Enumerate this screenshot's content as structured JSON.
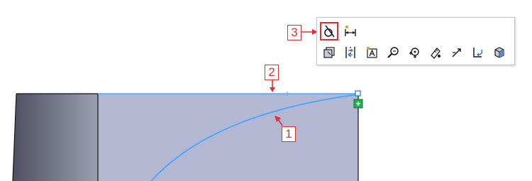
{
  "canvas": {
    "background": "#ffffff",
    "face_color": "#b3b7d2",
    "side_gradient": [
      "#4f5163",
      "#9a9eb0"
    ],
    "edge_color": "#111111",
    "sketch_color": "#4aa8ff",
    "endpoint_color": "#1bb24b"
  },
  "callouts": {
    "color": "#e0302c",
    "c1": "1",
    "c2": "2",
    "c3": "3"
  },
  "toolbar": {
    "row1": [
      {
        "icon": "tangent-relation-icon",
        "highlighted": true
      },
      {
        "icon": "smart-dimension-icon",
        "highlighted": false
      }
    ],
    "row2": [
      {
        "icon": "copy-entities-icon"
      },
      {
        "icon": "mirror-entities-icon"
      },
      {
        "icon": "sketch-text-icon"
      },
      {
        "icon": "zoom-to-selection-icon"
      },
      {
        "icon": "view-normal-to-icon"
      },
      {
        "icon": "measure-icon"
      },
      {
        "icon": "trim-entities-icon"
      },
      {
        "icon": "convert-entities-icon"
      },
      {
        "icon": "3d-view-icon"
      }
    ]
  }
}
